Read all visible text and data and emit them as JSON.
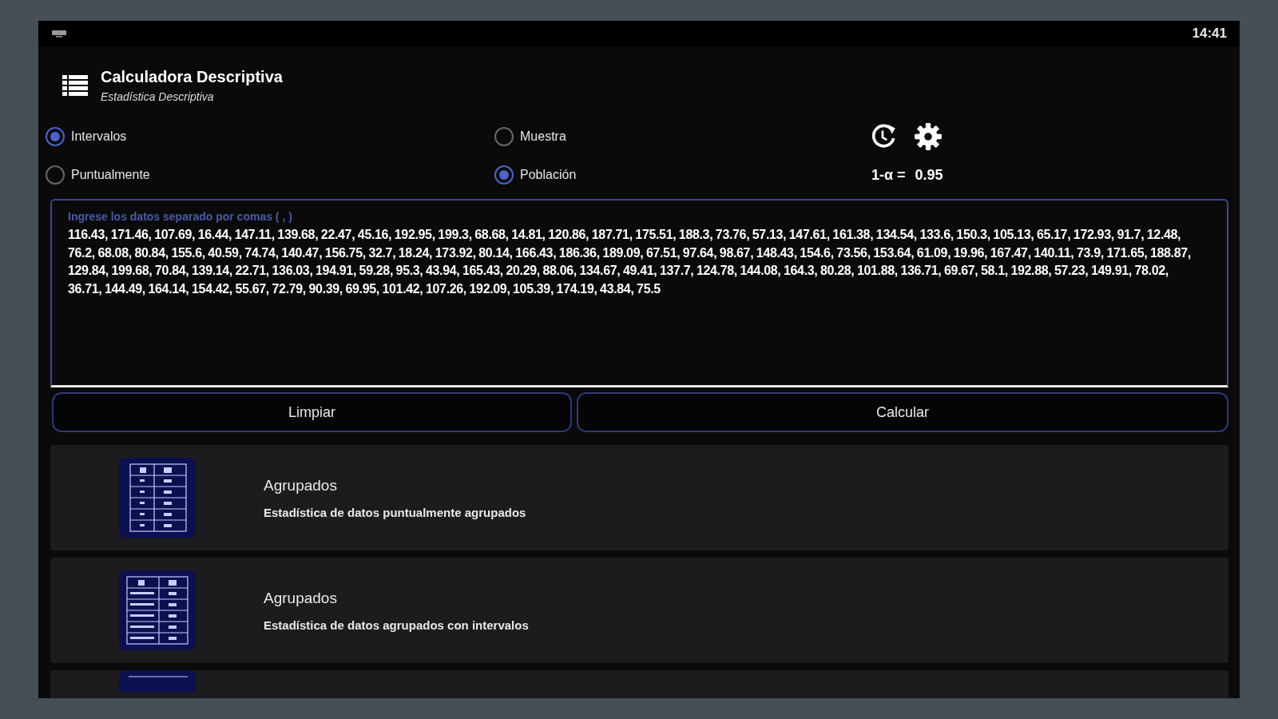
{
  "status_bar": {
    "time": "14:41"
  },
  "app_bar": {
    "title": "Calculadora Descriptiva",
    "subtitle": "Estadística Descriptiva"
  },
  "data_mode": [
    {
      "label": "Intervalos",
      "selected": true
    },
    {
      "label": "Puntualmente",
      "selected": false
    }
  ],
  "population_mode": [
    {
      "label": "Muestra",
      "selected": false
    },
    {
      "label": "Población",
      "selected": true
    }
  ],
  "confidence": {
    "label": "1-α =",
    "value": "0.95"
  },
  "data_field": {
    "label": "Ingrese los datos separado por comas ( , )",
    "value": "116.43, 171.46, 107.69, 16.44, 147.11, 139.68, 22.47, 45.16, 192.95, 199.3, 68.68, 14.81, 120.86, 187.71, 175.51, 188.3, 73.76, 57.13, 147.61, 161.38, 134.54, 133.6, 150.3, 105.13, 65.17, 172.93, 91.7, 12.48, 76.2, 68.08, 80.84, 155.6, 40.59, 74.74, 140.47, 156.75, 32.7, 18.24, 173.92, 80.14, 166.43, 186.36, 189.09, 67.51, 97.64, 98.67, 148.43, 154.6, 73.56, 153.64, 61.09, 19.96, 167.47, 140.11, 73.9, 171.65, 188.87, 129.84, 199.68, 70.84, 139.14, 22.71, 136.03, 194.91, 59.28, 95.3, 43.94, 165.43, 20.29, 88.06, 134.67, 49.41, 137.7, 124.78, 144.08, 164.3, 80.28, 101.88, 136.71, 69.67, 58.1, 192.88, 57.23, 149.91, 78.02, 36.71, 144.49, 164.14, 154.42, 55.67, 72.79, 90.39, 69.95, 101.42, 107.26, 192.09, 105.39, 174.19, 43.84, 75.5"
  },
  "buttons": [
    "Limpiar",
    "Calcular"
  ],
  "cards": [
    {
      "kind": "points",
      "title": "Agrupados",
      "subtitle": "Estadística de datos puntualmente agrupados"
    },
    {
      "kind": "intervals",
      "title": "Agrupados",
      "subtitle": "Estadística de datos agrupados con intervalos"
    }
  ]
}
